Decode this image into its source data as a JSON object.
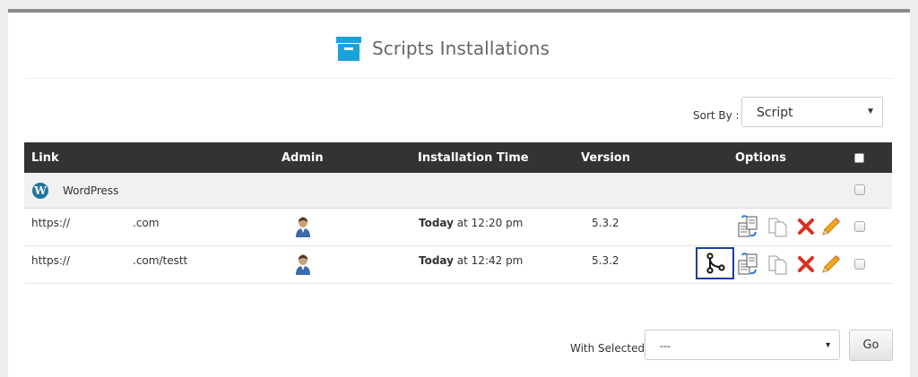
{
  "header": {
    "title": "Scripts Installations",
    "icon": "archive-box-icon",
    "accent_color": "#1aa3d9"
  },
  "sort": {
    "label": "Sort By :",
    "selected": "Script"
  },
  "table": {
    "columns": {
      "link": "Link",
      "admin": "Admin",
      "installation_time": "Installation Time",
      "version": "Version",
      "options": "Options"
    },
    "header_bg": "#333333",
    "group": {
      "name": "WordPress",
      "icon": "wordpress-logo-icon",
      "logo_letter": "W"
    },
    "rows": [
      {
        "link_prefix": "https://",
        "link_suffix": ".com",
        "time_day": "Today",
        "time_rest": " at 12:20 pm",
        "version": "5.3.2"
      },
      {
        "link_prefix": "https://",
        "link_suffix": ".com/testt",
        "time_day": "Today",
        "time_rest": " at 12:42 pm",
        "version": "5.3.2"
      }
    ]
  },
  "bulk": {
    "label": "With Selected:",
    "selected": "---",
    "go_label": "Go"
  }
}
